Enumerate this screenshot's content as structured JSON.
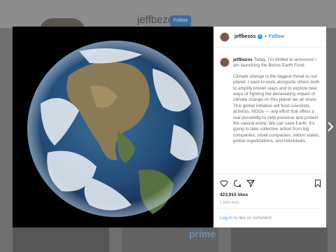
{
  "background": {
    "username": "jeffbezos",
    "follow_label": "Follow",
    "thumb_text": "prime"
  },
  "post": {
    "header": {
      "username": "jeffbezos",
      "separator": "•",
      "follow_label": "Follow",
      "icons": {
        "verified": "verified-badge-icon"
      }
    },
    "caption": {
      "username": "jeffbezos",
      "paragraph1": "Today, I’m thrilled to announce I am launching the Bezos Earth Fund.",
      "paragraph2": "Climate change is the biggest threat to our planet. I want to work alongside others both to amplify known ways and to explore new ways of fighting the devastating impact of climate change on this planet we all share. This global initiative will fund scientists, activists, NGOs — any effort that offers a real possibility to help preserve and protect the natural world. We can save Earth. It’s going to take collective action from big companies, small companies, nation states, global organizations, and individuals."
    },
    "actions": {
      "icons": [
        "heart-icon",
        "comment-icon",
        "share-icon",
        "bookmark-icon"
      ]
    },
    "likes": "423,915 likes",
    "time_ago": "1 DAY AGO",
    "login": {
      "link": "Log in",
      "rest": " to like or comment."
    }
  },
  "colors": {
    "accent": "#3897f0",
    "overlay": "#6f6f6f"
  }
}
